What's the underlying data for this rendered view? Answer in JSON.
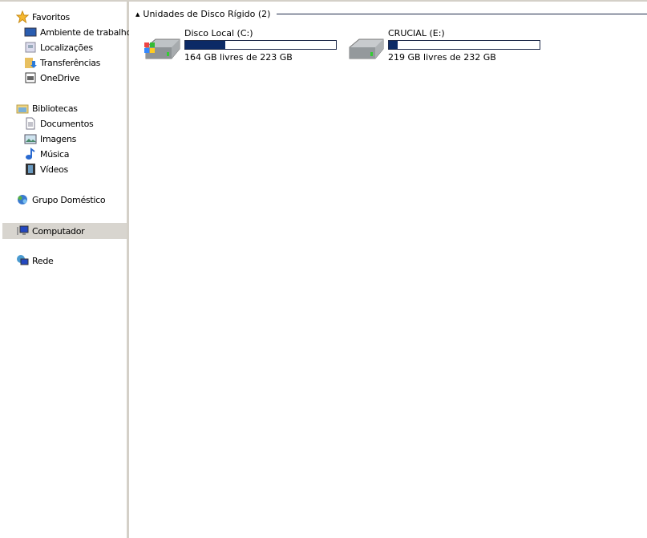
{
  "sidebar": {
    "favorites": {
      "label": "Favoritos",
      "items": [
        {
          "label": "Ambiente de trabalho"
        },
        {
          "label": "Localizações"
        },
        {
          "label": "Transferências"
        },
        {
          "label": "OneDrive"
        }
      ]
    },
    "libraries": {
      "label": "Bibliotecas",
      "items": [
        {
          "label": "Documentos"
        },
        {
          "label": "Imagens"
        },
        {
          "label": "Música"
        },
        {
          "label": "Vídeos"
        }
      ]
    },
    "homegroup": "Grupo Doméstico",
    "computer": "Computador",
    "network": "Rede"
  },
  "main": {
    "group_title": "Unidades de Disco Rígido (2)",
    "drives": [
      {
        "name": "Disco Local (C:)",
        "free": "164 GB livres de 223 GB",
        "used_percent": 26.5
      },
      {
        "name": "CRUCIAL (E:)",
        "free": "219 GB livres de 232 GB",
        "used_percent": 5.6
      }
    ]
  },
  "colors": {
    "bar_fill": "#0c2a66",
    "selection": "#d8d5cf"
  }
}
